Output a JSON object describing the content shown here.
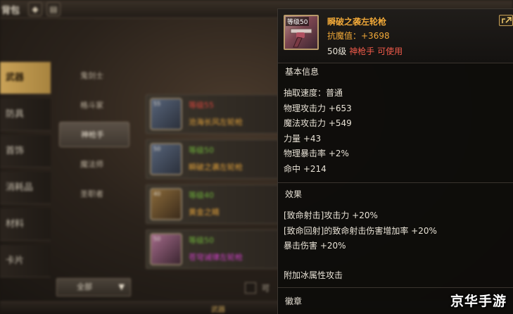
{
  "background": {
    "title": "背包",
    "categories": [
      {
        "label": "武器",
        "active": true
      },
      {
        "label": "防具",
        "active": false
      },
      {
        "label": "首饰",
        "active": false
      },
      {
        "label": "消耗品",
        "active": false
      },
      {
        "label": "材料",
        "active": false
      },
      {
        "label": "卡片",
        "active": false
      }
    ],
    "jobs": [
      {
        "label": "鬼剑士",
        "active": false
      },
      {
        "label": "格斗家",
        "active": false
      },
      {
        "label": "神枪手",
        "active": true
      },
      {
        "label": "魔法师",
        "active": false
      },
      {
        "label": "圣职者",
        "active": false
      }
    ],
    "items": [
      {
        "level": "等级55",
        "level_color": "#d9453c",
        "name": "沧海长风左轮枪",
        "name_color": "#e0a03a"
      },
      {
        "level": "等级50",
        "level_color": "#6fb33a",
        "name": "瞬破之袭左轮枪",
        "name_color": "#e0a03a"
      },
      {
        "level": "等级40",
        "level_color": "#6fb33a",
        "name": "黄金之睛",
        "name_color": "#e0a03a"
      },
      {
        "level": "等级50",
        "level_color": "#6fb33a",
        "name": "苍穹诫律左轮枪",
        "name_color": "#d040c8"
      }
    ],
    "filter_label": "全部",
    "checkbox_label": "可",
    "bottom_label": "武器"
  },
  "tooltip": {
    "icon_level": "等级50",
    "name": "瞬破之袭左轮枪",
    "resist": "抗魔值：+3698",
    "req_level": "50级",
    "req_class": "神枪手 可使用",
    "basic_section": "基本信息",
    "basic_stats": [
      "抽取速度：普通",
      "物理攻击力 +653",
      "魔法攻击力 +549",
      "力量 +43",
      "物理暴击率 +2%",
      "命中 +214"
    ],
    "effect_section": "效果",
    "effects": [
      "[致命射击]攻击力 +20%",
      "[致命回射]的致命射击伤害增加率 +20%",
      "暴击伤害 +20%"
    ],
    "extra_effect": "附加冰属性攻击",
    "emblem_section": "徽章"
  },
  "watermark": "京华手游",
  "icons": {
    "ext": "external-link-icon",
    "gun": "revolver-icon",
    "dropdown": "triangle-down-icon"
  }
}
